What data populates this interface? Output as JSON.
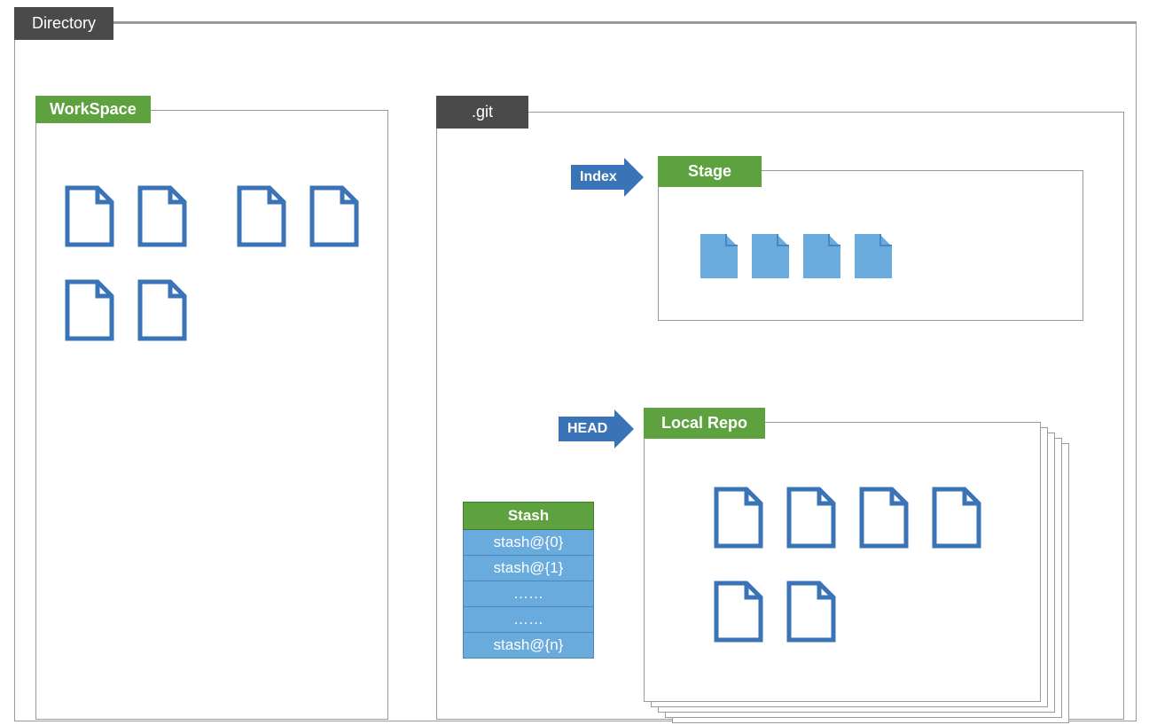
{
  "diagram": {
    "colors": {
      "green": "#5da23e",
      "darkgray": "#4a4a4a",
      "blue": "#3a74b7",
      "lightblue": "#6aabde",
      "border": "#9a9a9a"
    },
    "directory_label": "Directory",
    "workspace_label": "WorkSpace",
    "git_label": ".git",
    "index_arrow_label": "Index",
    "stage_label": "Stage",
    "head_arrow_label": "HEAD",
    "localrepo_label": "Local Repo",
    "stash": {
      "header": "Stash",
      "rows": [
        "stash@{0}",
        "stash@{1}",
        "……",
        "……",
        "stash@{n}"
      ]
    },
    "workspace_file_count": 6,
    "stage_file_count": 4,
    "localrepo_file_count": 6
  }
}
